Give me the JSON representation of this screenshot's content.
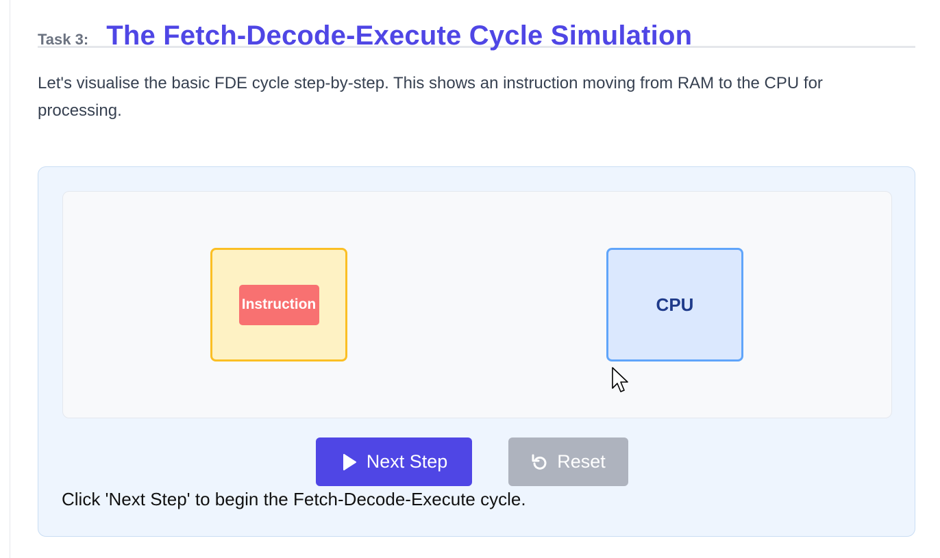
{
  "heading": {
    "task_label": "Task 3:",
    "title": "The Fetch-Decode-Execute Cycle Simulation"
  },
  "intro": "Let's visualise the basic FDE cycle step-by-step. This shows an instruction moving from RAM to the CPU for processing.",
  "simulation": {
    "instruction_label": "Instruction",
    "cpu_label": "CPU",
    "next_button_label": "Next Step",
    "reset_button_label": "Reset",
    "status_text": "Click 'Next Step' to begin the Fetch-Decode-Execute cycle."
  },
  "icons": {
    "next": "play-icon",
    "reset": "undo-icon"
  },
  "colors": {
    "accent": "#4f46e5",
    "ram_fill": "#fef2c4",
    "ram_border": "#fbbf24",
    "instruction": "#f87171",
    "cpu_fill": "#dbe8fe",
    "cpu_border": "#60a5fa",
    "reset_disabled": "#aeb3be"
  }
}
